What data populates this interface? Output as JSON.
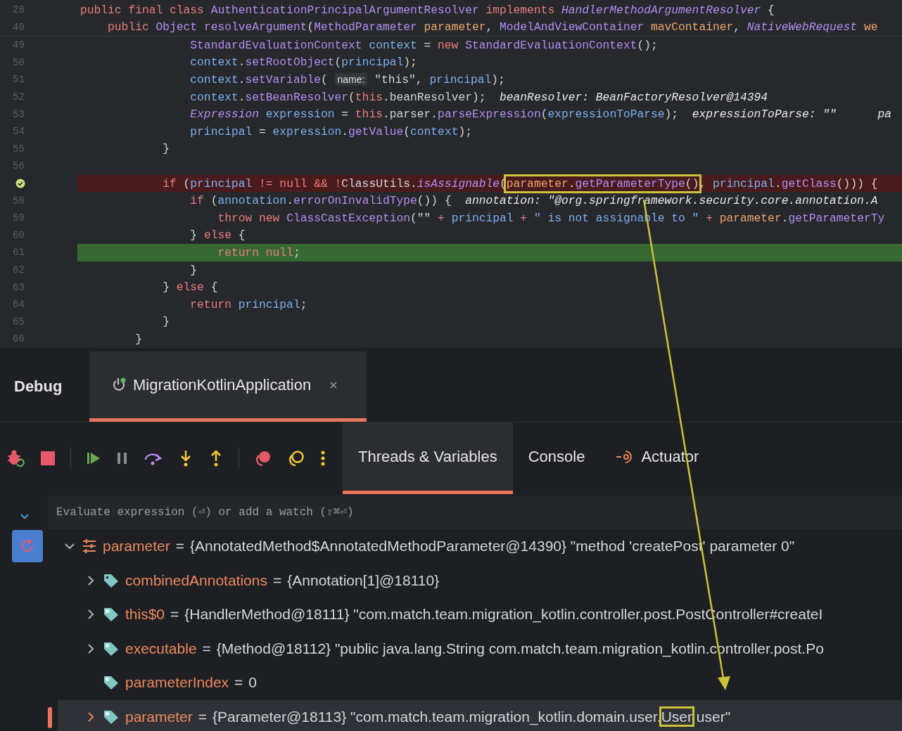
{
  "editor": {
    "sticky_lines": [
      {
        "number": "28",
        "tokens": [
          {
            "kind": "kw",
            "text": "public final class "
          },
          {
            "kind": "type",
            "text": "AuthenticationPrincipalArgumentResolver "
          },
          {
            "kind": "kw",
            "text": "implements "
          },
          {
            "kind": "itype",
            "text": "HandlerMethodArgumentResolver "
          },
          {
            "kind": "plain",
            "text": "{"
          }
        ]
      },
      {
        "number": "40",
        "tokens": [
          {
            "kind": "kw",
            "text": "    public "
          },
          {
            "kind": "type",
            "text": "Object "
          },
          {
            "kind": "method",
            "text": "resolveArgument"
          },
          {
            "kind": "plain",
            "text": "("
          },
          {
            "kind": "type",
            "text": "MethodParameter "
          },
          {
            "kind": "param",
            "text": "parameter"
          },
          {
            "kind": "plain",
            "text": ", "
          },
          {
            "kind": "type",
            "text": "ModelAndViewContainer "
          },
          {
            "kind": "param",
            "text": "mavContainer"
          },
          {
            "kind": "plain",
            "text": ", "
          },
          {
            "kind": "itype",
            "text": "NativeWebRequest "
          },
          {
            "kind": "param",
            "text": "we"
          }
        ]
      }
    ],
    "lines": [
      {
        "number": "49",
        "kind": "normal",
        "tokens": [
          {
            "kind": "type",
            "text": "                StandardEvaluationContext "
          },
          {
            "kind": "var",
            "text": "context"
          },
          {
            "kind": "plain",
            "text": " = "
          },
          {
            "kind": "kw",
            "text": "new "
          },
          {
            "kind": "type",
            "text": "StandardEvaluationContext"
          },
          {
            "kind": "plain",
            "text": "();"
          }
        ]
      },
      {
        "number": "50",
        "kind": "normal",
        "tokens": [
          {
            "kind": "var",
            "text": "                context"
          },
          {
            "kind": "plain",
            "text": "."
          },
          {
            "kind": "method",
            "text": "setRootObject"
          },
          {
            "kind": "plain",
            "text": "("
          },
          {
            "kind": "var",
            "text": "principal"
          },
          {
            "kind": "plain",
            "text": ");"
          }
        ]
      },
      {
        "number": "51",
        "kind": "normal",
        "tokens": [
          {
            "kind": "var",
            "text": "                context"
          },
          {
            "kind": "plain",
            "text": "."
          },
          {
            "kind": "method",
            "text": "setVariable"
          },
          {
            "kind": "plain",
            "text": "( "
          },
          {
            "kind": "namehint",
            "text": "name:"
          },
          {
            "kind": "plain",
            "text": " \"this\", "
          },
          {
            "kind": "var",
            "text": "principal"
          },
          {
            "kind": "plain",
            "text": ");"
          }
        ]
      },
      {
        "number": "52",
        "kind": "normal",
        "tokens": [
          {
            "kind": "var",
            "text": "                context"
          },
          {
            "kind": "plain",
            "text": "."
          },
          {
            "kind": "method",
            "text": "setBeanResolver"
          },
          {
            "kind": "plain",
            "text": "("
          },
          {
            "kind": "kw",
            "text": "this"
          },
          {
            "kind": "plain",
            "text": ".beanResolver);"
          },
          {
            "kind": "hint",
            "text": "  beanResolver: BeanFactoryResolver@14394"
          }
        ]
      },
      {
        "number": "53",
        "kind": "normal",
        "tokens": [
          {
            "kind": "itype",
            "text": "                Expression "
          },
          {
            "kind": "var",
            "text": "expression"
          },
          {
            "kind": "plain",
            "text": " = "
          },
          {
            "kind": "kw",
            "text": "this"
          },
          {
            "kind": "plain",
            "text": ".parser."
          },
          {
            "kind": "method",
            "text": "parseExpression"
          },
          {
            "kind": "plain",
            "text": "("
          },
          {
            "kind": "var",
            "text": "expressionToParse"
          },
          {
            "kind": "plain",
            "text": ");"
          },
          {
            "kind": "hint",
            "text": "  expressionToParse: \"\""
          },
          {
            "kind": "hint",
            "text": "      pa"
          }
        ]
      },
      {
        "number": "54",
        "kind": "normal",
        "tokens": [
          {
            "kind": "var",
            "text": "                principal"
          },
          {
            "kind": "plain",
            "text": " = "
          },
          {
            "kind": "var",
            "text": "expression"
          },
          {
            "kind": "plain",
            "text": "."
          },
          {
            "kind": "method",
            "text": "getValue"
          },
          {
            "kind": "plain",
            "text": "("
          },
          {
            "kind": "var",
            "text": "context"
          },
          {
            "kind": "plain",
            "text": ");"
          }
        ]
      },
      {
        "number": "55",
        "kind": "normal",
        "tokens": [
          {
            "kind": "plain",
            "text": "            }"
          }
        ]
      },
      {
        "number": "56",
        "kind": "normal"
      },
      {
        "kind": "breakpoint",
        "tokens": [
          {
            "kind": "kw",
            "text": "            if "
          },
          {
            "kind": "plain",
            "text": "("
          },
          {
            "kind": "var",
            "text": "principal"
          },
          {
            "kind": "kw",
            "text": " != null && !"
          },
          {
            "kind": "plain",
            "text": "ClassUtils."
          },
          {
            "kind": "static",
            "text": "isAssignable"
          },
          {
            "kind": "plain",
            "text": "("
          },
          {
            "kind": "boxed",
            "parts": [
              {
                "kind": "param",
                "text": "parameter"
              },
              {
                "kind": "plain",
                "text": "."
              },
              {
                "kind": "method",
                "text": "getParameterType"
              },
              {
                "kind": "plain",
                "text": "()"
              }
            ]
          },
          {
            "kind": "plain",
            "text": ", "
          },
          {
            "kind": "var",
            "text": "principal"
          },
          {
            "kind": "plain",
            "text": "."
          },
          {
            "kind": "method",
            "text": "getClass"
          },
          {
            "kind": "plain",
            "text": "())) {"
          }
        ]
      },
      {
        "number": "58",
        "kind": "normal",
        "tokens": [
          {
            "kind": "kw",
            "text": "                if "
          },
          {
            "kind": "plain",
            "text": "("
          },
          {
            "kind": "var",
            "text": "annotation"
          },
          {
            "kind": "plain",
            "text": "."
          },
          {
            "kind": "method",
            "text": "errorOnInvalidType"
          },
          {
            "kind": "plain",
            "text": "()) {"
          },
          {
            "kind": "hint",
            "text": "  annotation: \"@org.springframework.security.core.annotation.A"
          }
        ]
      },
      {
        "number": "59",
        "kind": "normal",
        "tokens": [
          {
            "kind": "kw",
            "text": "                    throw new "
          },
          {
            "kind": "type",
            "text": "ClassCastException"
          },
          {
            "kind": "plain",
            "text": "(\"\" "
          },
          {
            "kind": "kw",
            "text": "+ "
          },
          {
            "kind": "var",
            "text": "principal "
          },
          {
            "kind": "kw",
            "text": "+ "
          },
          {
            "kind": "var",
            "text": "\" is not assignable to \" "
          },
          {
            "kind": "kw",
            "text": "+ "
          },
          {
            "kind": "param",
            "text": "parameter"
          },
          {
            "kind": "plain",
            "text": "."
          },
          {
            "kind": "method",
            "text": "getParameterTy"
          }
        ]
      },
      {
        "number": "60",
        "kind": "normal",
        "tokens": [
          {
            "kind": "plain",
            "text": "                } "
          },
          {
            "kind": "kw",
            "text": "else "
          },
          {
            "kind": "plain",
            "text": "{"
          }
        ]
      },
      {
        "number": "61",
        "kind": "current",
        "tokens": [
          {
            "kind": "kw",
            "text": "                    return null"
          },
          {
            "kind": "plain",
            "text": ";"
          }
        ]
      },
      {
        "number": "62",
        "kind": "normal",
        "tokens": [
          {
            "kind": "plain",
            "text": "                }"
          }
        ]
      },
      {
        "number": "63",
        "kind": "normal",
        "tokens": [
          {
            "kind": "plain",
            "text": "            } "
          },
          {
            "kind": "kw",
            "text": "else "
          },
          {
            "kind": "plain",
            "text": "{"
          }
        ]
      },
      {
        "number": "64",
        "kind": "normal",
        "tokens": [
          {
            "kind": "kw",
            "text": "                return "
          },
          {
            "kind": "var",
            "text": "principal"
          },
          {
            "kind": "plain",
            "text": ";"
          }
        ]
      },
      {
        "number": "65",
        "kind": "normal",
        "tokens": [
          {
            "kind": "plain",
            "text": "            }"
          }
        ]
      },
      {
        "number": "66",
        "kind": "normal",
        "tokens": [
          {
            "kind": "plain",
            "text": "        }"
          }
        ]
      }
    ]
  },
  "debug": {
    "title": "Debug",
    "session_tabs": [
      {
        "label": "MigrationKotlinApplication",
        "selected": true
      }
    ],
    "view_tabs": [
      {
        "label": "Threads & Variables",
        "kind": "text",
        "selected": true
      },
      {
        "label": "Console",
        "kind": "text",
        "selected": false
      },
      {
        "label": "Actuator",
        "kind": "actuator",
        "selected": false
      }
    ],
    "evaluate": {
      "placeholder": "Evaluate expression (⏎) or add a watch (⇧⌘⏎)"
    },
    "variables": [
      {
        "name": "parameter",
        "kind": "object",
        "expandable": true,
        "expanded": true,
        "selected": false,
        "equals": "=",
        "value": [
          {
            "kind": "text",
            "text": "{AnnotatedMethod$AnnotatedMethodParameter@14390} \"method 'createPost' parameter 0\""
          }
        ],
        "children": [
          {
            "name": "combinedAnnotations",
            "kind": "field",
            "expandable": true,
            "equals": "=",
            "selected": false,
            "value": [
              {
                "kind": "text",
                "text": "{Annotation[1]@18110}"
              }
            ]
          },
          {
            "name": "this$0",
            "kind": "final-field",
            "expandable": true,
            "equals": "=",
            "selected": false,
            "value": [
              {
                "kind": "text",
                "text": "{HandlerMethod@18111} \"com.match.team.migration_kotlin.controller.post.PostController#createI"
              }
            ]
          },
          {
            "name": "executable",
            "kind": "final-field",
            "expandable": true,
            "equals": "=",
            "selected": false,
            "value": [
              {
                "kind": "text",
                "text": "{Method@18112} \"public java.lang.String com.match.team.migration_kotlin.controller.post.Po"
              }
            ]
          },
          {
            "name": "parameterIndex",
            "kind": "final-field",
            "expandable": false,
            "equals": "=",
            "selected": false,
            "value": [
              {
                "kind": "text",
                "text": "0"
              }
            ]
          },
          {
            "name": "parameter",
            "kind": "final-field",
            "expandable": true,
            "equals": "=",
            "selected": true,
            "value": [
              {
                "kind": "text",
                "text": "{Parameter@18113} \"com.match.team.migration_kotlin.domain.user."
              },
              {
                "kind": "boxed",
                "text": "User"
              },
              {
                "kind": "text",
                "text": " user\""
              }
            ]
          }
        ]
      }
    ]
  }
}
